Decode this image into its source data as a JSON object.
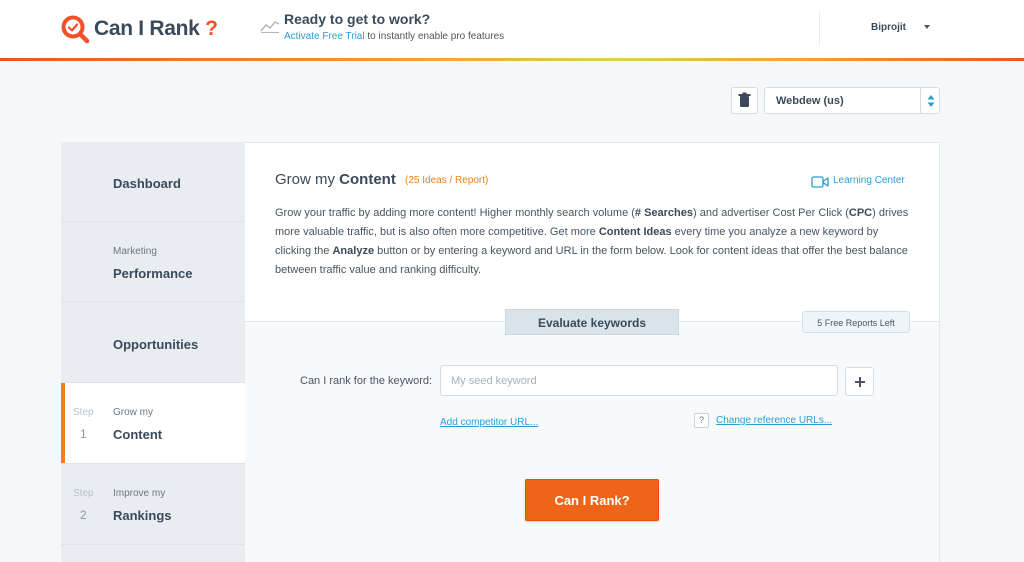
{
  "header": {
    "logo_text": "Can I Rank",
    "logo_q": "?",
    "promo_title": "Ready to get to work?",
    "promo_link": "Activate Free Trial",
    "promo_rest": " to instantly enable pro features",
    "user_name": "Biprojit"
  },
  "toolbar": {
    "site_selected": "Webdew (us)"
  },
  "sidebar": {
    "items": [
      {
        "small": "",
        "big": "Dashboard"
      },
      {
        "small": "Marketing",
        "big": "Performance"
      },
      {
        "small": "",
        "big": "Opportunities"
      },
      {
        "step": "Step",
        "num": "1",
        "small": "Grow my",
        "big": "Content"
      },
      {
        "step": "Step",
        "num": "2",
        "small": "Improve my",
        "big": "Rankings"
      }
    ]
  },
  "main": {
    "title_prefix": "Grow my ",
    "title_bold": "Content",
    "badge": "(25 Ideas / Report)",
    "learning_center": "Learning Center",
    "desc": {
      "p1": "Grow your traffic by adding more content! Higher monthly search volume (",
      "b1": "# Searches",
      "p2": ") and advertiser Cost Per Click (",
      "b2": "CPC",
      "p3": ") drives more valuable traffic, but is also often more competitive. Get more ",
      "b3": "Content Ideas",
      "p4": " every time you analyze a new keyword by clicking the ",
      "b4": "Analyze",
      "p5": " button or by entering a keyword and URL in the form below. Look for content ideas that offer the best balance between traffic value and ranking difficulty."
    },
    "eval_tab": "Evaluate keywords",
    "free_reports": "5 Free Reports Left",
    "kw_label": "Can I rank for the keyword:",
    "kw_placeholder": "My seed keyword",
    "competitor_link": "Add competitor URL...",
    "help_glyph": "?",
    "reference_link": "Change reference URLs...",
    "cta": "Can I Rank?"
  },
  "colors": {
    "accent": "#f06418",
    "link": "#2a9fd6",
    "active_bar": "#f0801a"
  }
}
